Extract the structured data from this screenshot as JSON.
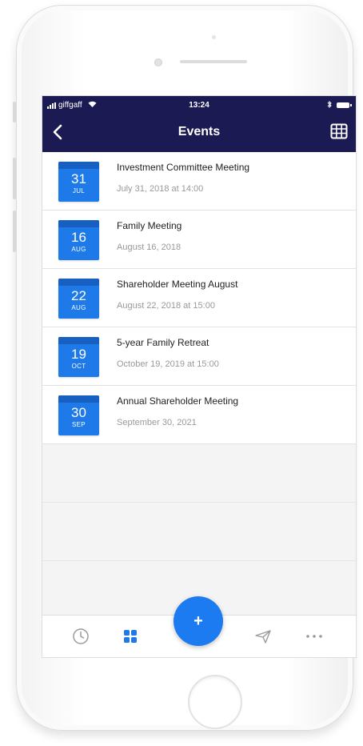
{
  "status_bar": {
    "carrier": "giffgaff",
    "time": "13:24"
  },
  "header": {
    "title": "Events"
  },
  "events": [
    {
      "day": "31",
      "month": "JUL",
      "title": "Investment Committee Meeting",
      "date": "July 31, 2018 at 14:00"
    },
    {
      "day": "16",
      "month": "AUG",
      "title": "Family Meeting",
      "date": "August 16, 2018"
    },
    {
      "day": "22",
      "month": "AUG",
      "title": "Shareholder Meeting August",
      "date": "August 22, 2018 at 15:00"
    },
    {
      "day": "19",
      "month": "OCT",
      "title": "5-year Family Retreat",
      "date": "October 19, 2019 at 15:00"
    },
    {
      "day": "30",
      "month": "SEP",
      "title": "Annual Shareholder Meeting",
      "date": "September 30, 2021"
    }
  ],
  "tabbar": {
    "add_label": "+",
    "items": [
      "clock-icon",
      "grid-icon",
      "send-icon",
      "more-icon"
    ]
  },
  "colors": {
    "header_bg": "#1c1a52",
    "accent": "#1d7ae8",
    "fab": "#1c7bf0"
  }
}
